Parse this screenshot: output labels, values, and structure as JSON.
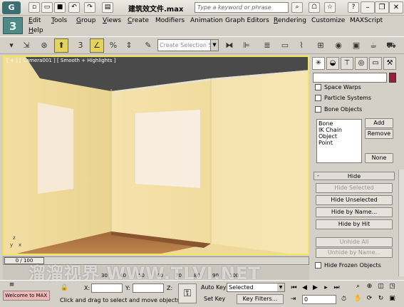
{
  "titlebar": {
    "file_title": "建筑效文件.max",
    "search_placeholder": "Type a keyword or phrase"
  },
  "menu": {
    "items": [
      {
        "ul": "E",
        "rest": "dit"
      },
      {
        "ul": "T",
        "rest": "ools"
      },
      {
        "ul": "G",
        "rest": "roup"
      },
      {
        "ul": "V",
        "rest": "iews"
      },
      {
        "ul": "C",
        "rest": "reate"
      },
      {
        "ul": "",
        "rest": "Modifiers"
      },
      {
        "ul": "",
        "rest": "Animation"
      },
      {
        "ul": "",
        "rest": "Graph Editors"
      },
      {
        "ul": "R",
        "rest": "endering"
      },
      {
        "ul": "",
        "rest": "Customize"
      },
      {
        "ul": "",
        "rest": "MAXScript"
      },
      {
        "ul": "H",
        "rest": "elp"
      }
    ]
  },
  "toolbar": {
    "selection_set_placeholder": "Create Selection Set",
    "spinner_label": "3"
  },
  "viewport": {
    "label": "[ + ] [ Camera001 ] [ Smooth + Highlights ]",
    "wall_color": "#f3dfa5",
    "floor_color": "#a06a3a",
    "ceiling_color": "#4a4a4a"
  },
  "command_panel": {
    "checkboxes": [
      "Space Warps",
      "Particle Systems",
      "Bone Objects"
    ],
    "list_items": [
      "Bone",
      "IK Chain Object",
      "Point"
    ],
    "add_button": "Add",
    "remove_button": "Remove",
    "none_button": "None",
    "hide_rollout_title": "Hide",
    "hide_rollout_minus": "-",
    "hide_buttons": [
      {
        "label": "Hide Selected",
        "enabled": false
      },
      {
        "label": "Hide Unselected",
        "enabled": true
      },
      {
        "label": "Hide by Name...",
        "enabled": true
      },
      {
        "label": "Hide by Hit",
        "enabled": true
      },
      {
        "label": "Unhide All",
        "enabled": false
      },
      {
        "label": "Unhide by Name...",
        "enabled": false
      }
    ],
    "hide_frozen": "Hide Frozen Objects",
    "accent_color": "#9a1c3c"
  },
  "timeline": {
    "slider_value": "0 / 100",
    "ticks": [
      "30",
      "40",
      "50",
      "60",
      "70",
      "80",
      "90",
      "100"
    ],
    "watermark": "溜溜视界 WWW.TLVI.NET"
  },
  "status": {
    "maxscript": "Welcome to MAX",
    "x_label": "X:",
    "y_label": "Y:",
    "z_label": "Z:",
    "prompt": "Click and drag to select and move objects",
    "auto_key": "Auto Key",
    "set_key": "Set Key",
    "key_filters": "Key Filters...",
    "selected": "Selected",
    "frame": "0"
  }
}
